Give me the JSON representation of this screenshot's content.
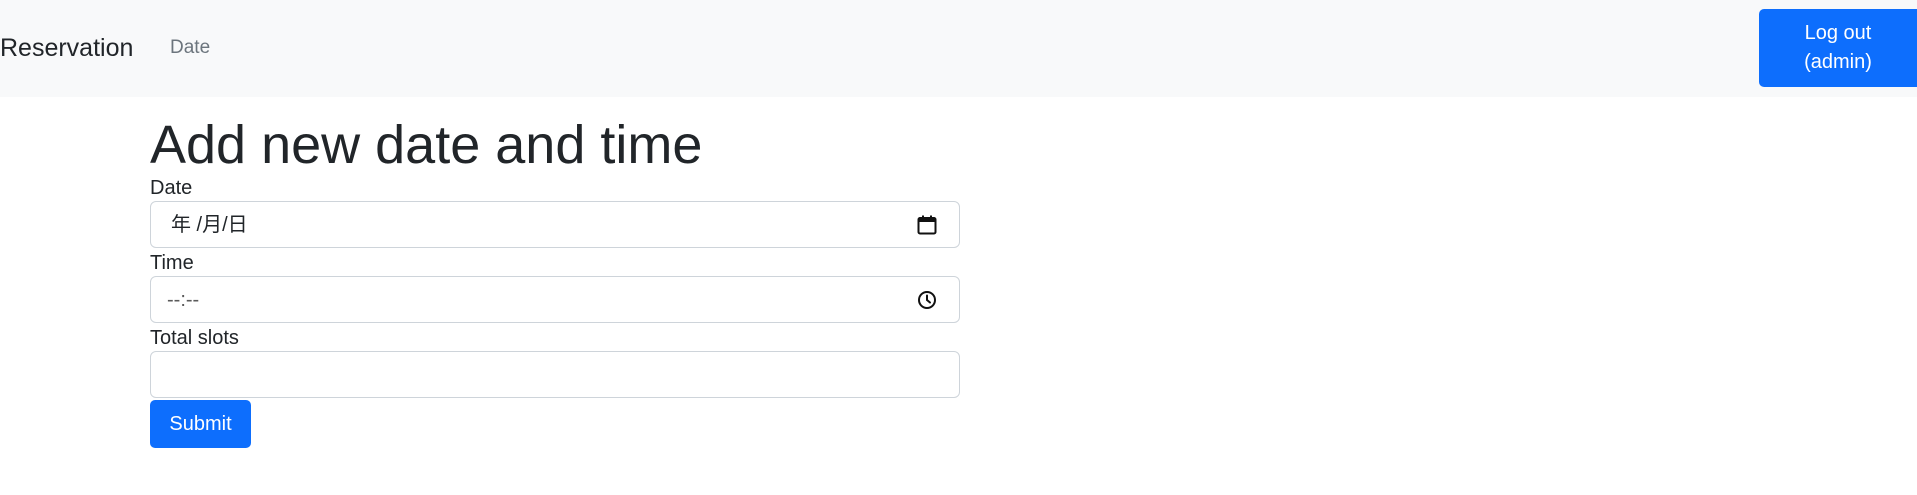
{
  "navbar": {
    "brand": "Reservation",
    "links": [
      {
        "label": "Date"
      }
    ],
    "logout": {
      "line1": "Log out",
      "line2": "(admin)"
    }
  },
  "main": {
    "title": "Add new date and time",
    "fields": {
      "date": {
        "label": "Date",
        "value": "年 /月/日",
        "icon": "calendar-icon"
      },
      "time": {
        "label": "Time",
        "value": "--:--",
        "icon": "clock-icon"
      },
      "total_slots": {
        "label": "Total slots",
        "value": ""
      }
    },
    "submit_label": "Submit"
  },
  "colors": {
    "primary": "#0d6efd",
    "navbar_bg": "#f8f9fa",
    "muted_link": "#6c757d",
    "input_border": "#ced4da",
    "text": "#212529"
  }
}
